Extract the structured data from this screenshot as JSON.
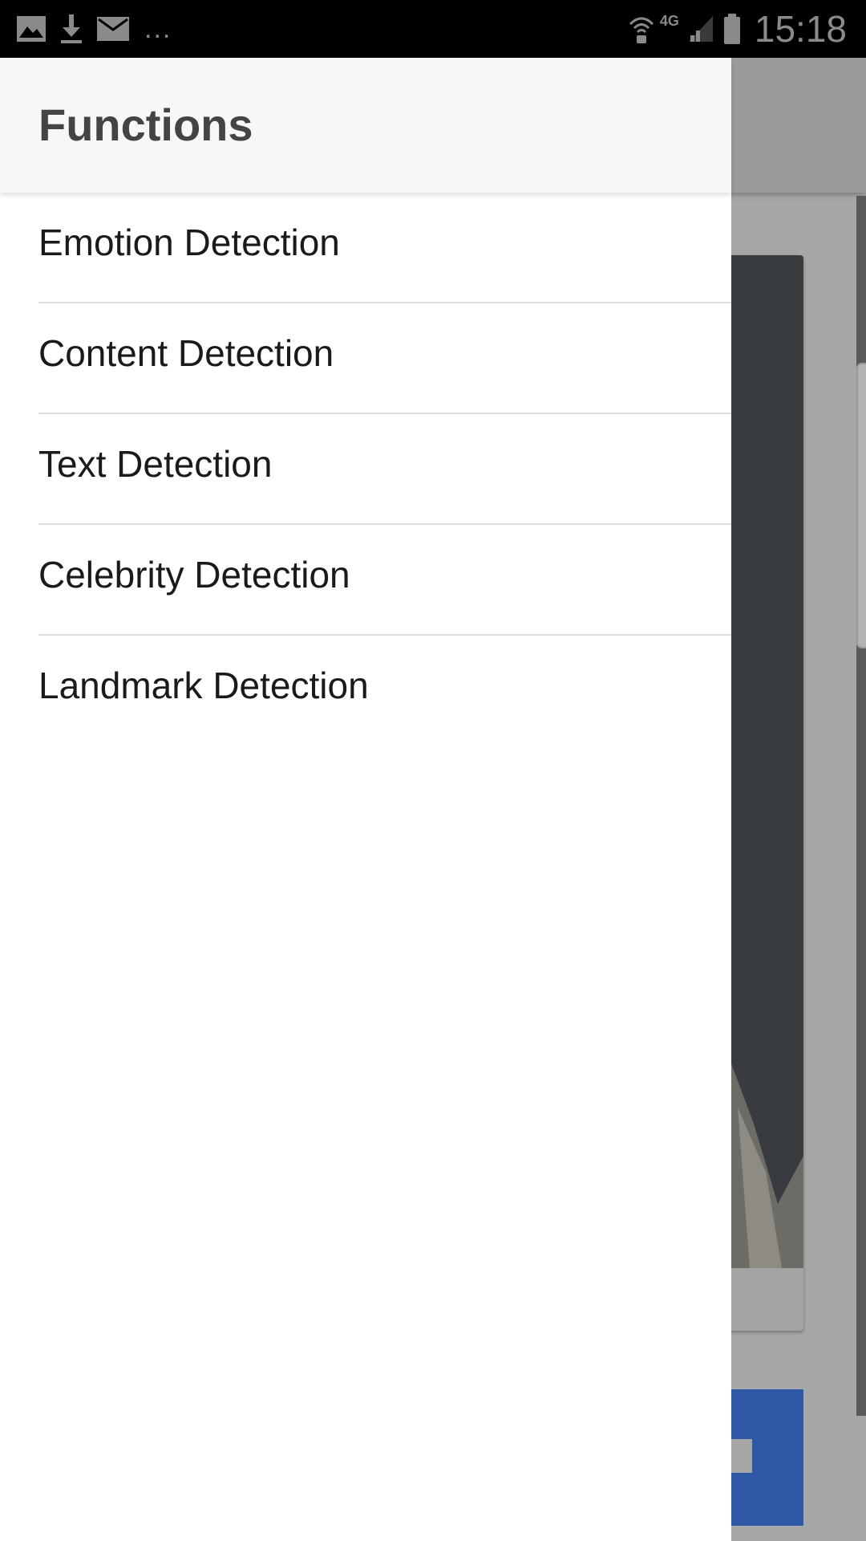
{
  "status_bar": {
    "left_icons": [
      "gallery-icon",
      "download-icon",
      "mail-icon"
    ],
    "more_indicator": "...",
    "network_type": "4G",
    "right_icons": [
      "wifi-calling-icon",
      "signal-icon",
      "battery-icon"
    ],
    "time": "15:18"
  },
  "drawer": {
    "title": "Functions",
    "items": [
      {
        "label": "Emotion Detection"
      },
      {
        "label": "Content Detection"
      },
      {
        "label": "Text Detection"
      },
      {
        "label": "Celebrity Detection"
      },
      {
        "label": "Landmark Detection"
      }
    ]
  },
  "colors": {
    "drawer_background": "#ffffff",
    "drawer_header_background": "#f7f7f7",
    "title_text": "#444444",
    "item_text": "#1a1a1a",
    "divider": "#dddddd",
    "scrim": "#a7a7a7",
    "accent_button": "#2f58a6"
  }
}
